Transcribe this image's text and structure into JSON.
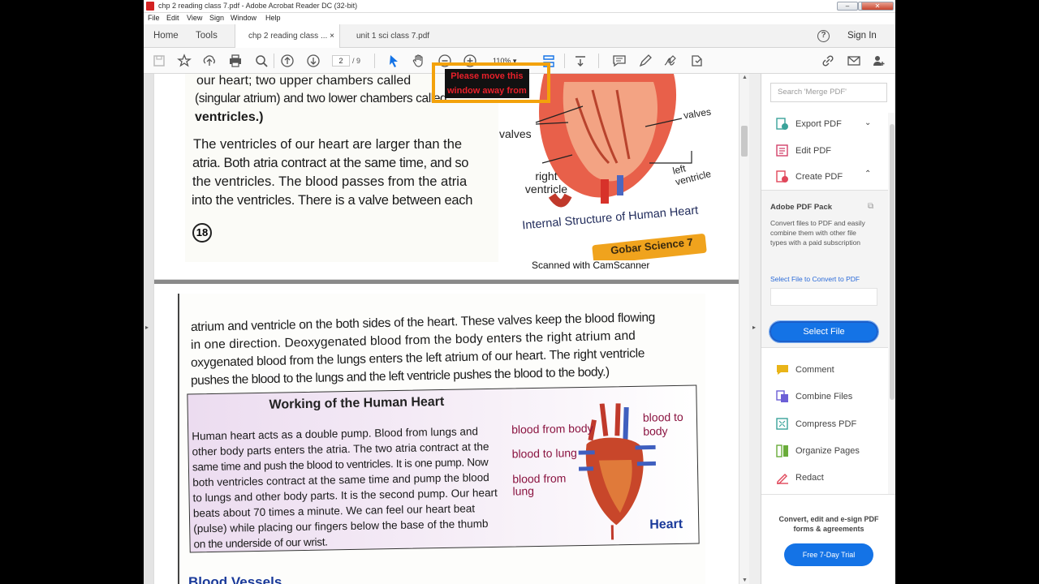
{
  "window": {
    "title": "chp 2 reading class 7.pdf - Adobe Acrobat Reader DC (32-bit)",
    "buttons": {
      "minimize": "–",
      "restore": "❐",
      "close": "✕"
    }
  },
  "menu": [
    "File",
    "Edit",
    "View",
    "Sign",
    "Window",
    "Help"
  ],
  "tabs": {
    "home": "Home",
    "tools": "Tools",
    "documents": [
      {
        "label": "chp 2 reading class ...",
        "active": true
      },
      {
        "label": "unit 1 sci class 7.pdf",
        "active": false
      }
    ],
    "close_glyph": "×",
    "help": "?",
    "sign_in": "Sign In"
  },
  "toolbar": {
    "page_current": "2",
    "page_total": "/ 9",
    "zoom": "110%",
    "icons": [
      "save-icon",
      "bookmark-star-icon",
      "upload-icon",
      "print-icon",
      "zoom-search-icon",
      "page-up-icon",
      "page-down-icon",
      "select-arrow-icon",
      "hand-icon",
      "zoom-out-icon",
      "zoom-in-icon",
      "fit-page-icon",
      "download-icon",
      "comment-icon",
      "pen-icon",
      "sign-icon",
      "stamp-icon",
      "share-link-icon",
      "email-icon",
      "add-user-icon"
    ]
  },
  "overlay": {
    "line1": "Please move this",
    "line2": "window away from"
  },
  "page1": {
    "lines_top": [
      "our heart; two upper chambers called",
      "(singular atrium) and two lower chambers called",
      "ventricles.)"
    ],
    "paragraph": [
      "The ventricles of our heart are larger than the",
      "atria. Both atria contract at the same time, and so",
      "the ventricles. The blood passes from the atria",
      "into the ventricles. There is a valve between each"
    ],
    "page_number": "18",
    "figure": {
      "labels": [
        "valves",
        "valves",
        "right ventricle",
        "left ventricle"
      ],
      "caption": "Internal Structure of Human Heart",
      "banner": "Gobar Science 7"
    },
    "watermark": "Scanned with CamScanner"
  },
  "page2": {
    "paragraph": [
      "atrium and ventricle on the both sides of the heart. These valves keep the blood flowing",
      "in one direction.  Deoxygenated blood from the body enters the right atrium and",
      "oxygenated blood from the lungs enters the  left atrium of our heart. The right ventricle",
      "pushes the blood to the lungs and the left ventricle pushes the blood to the body.)"
    ],
    "box_title": "Working of the Human Heart",
    "box_text": [
      "Human heart acts as a double pump. Blood from lungs and",
      "other body parts enters the atria. The two atria contract at the",
      "same time and push the blood to ventricles. It is one pump. Now",
      "both ventricles contract at the same time and pump the blood",
      "to lungs and other body parts. It is the second pump. Our heart",
      "beats about 70 times a minute. We can feel our heart beat",
      "(pulse) while placing our fingers below the base of the thumb",
      "on the underside of our wrist."
    ],
    "figure_labels": [
      "blood from body",
      "blood to lung",
      "blood from lung",
      "blood to body",
      "Heart"
    ],
    "next_heading": "Blood Vessels"
  },
  "panel": {
    "search_placeholder": "Search 'Merge PDF'",
    "tools_top": [
      {
        "label": "Export PDF",
        "icon": "export-pdf-icon",
        "color": "#3aa39a"
      },
      {
        "label": "Edit PDF",
        "icon": "edit-pdf-icon",
        "color": "#d2416a"
      },
      {
        "label": "Create PDF",
        "icon": "create-pdf-icon",
        "color": "#e0475a"
      }
    ],
    "pack": {
      "title": "Adobe PDF Pack",
      "description": "Convert files to PDF and easily combine them with other file types with a paid subscription",
      "link": "Select File to Convert to PDF",
      "button": "Select File"
    },
    "tools_bottom": [
      {
        "label": "Comment",
        "icon": "comment-tool-icon",
        "color": "#e9b418"
      },
      {
        "label": "Combine Files",
        "icon": "combine-files-icon",
        "color": "#6c5fd6"
      },
      {
        "label": "Compress PDF",
        "icon": "compress-pdf-icon",
        "color": "#3aa39a"
      },
      {
        "label": "Organize Pages",
        "icon": "organize-pages-icon",
        "color": "#6aac3a"
      },
      {
        "label": "Redact",
        "icon": "redact-icon",
        "color": "#e0475a"
      }
    ],
    "promo": "Convert, edit and e-sign PDF forms & agreements",
    "trial_button": "Free 7-Day Trial"
  }
}
